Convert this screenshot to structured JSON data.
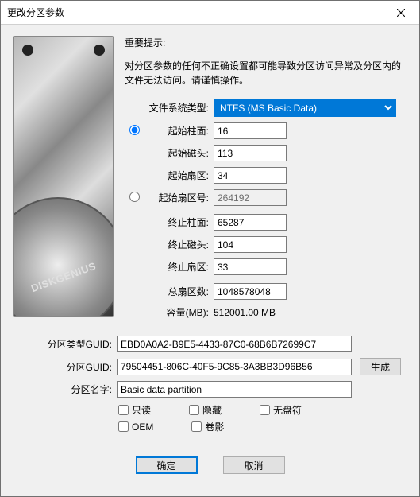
{
  "window": {
    "title": "更改分区参数"
  },
  "important_header": "重要提示:",
  "warning": "对分区参数的任何不正确设置都可能导致分区访问异常及分区内的文件无法访问。请谨慎操作。",
  "labels": {
    "fs_type": "文件系统类型:",
    "start_cyl": "起始柱面:",
    "start_head": "起始磁头:",
    "start_sector": "起始扇区:",
    "start_sector_no": "起始扇区号:",
    "end_cyl": "终止柱面:",
    "end_head": "终止磁头:",
    "end_sector": "终止扇区:",
    "total_sectors": "总扇区数:",
    "capacity_mb": "容量(MB):",
    "part_type_guid": "分区类型GUID:",
    "part_guid": "分区GUID:",
    "part_name": "分区名字:"
  },
  "values": {
    "fs_type": "NTFS (MS Basic Data)",
    "start_cyl": "16",
    "start_head": "113",
    "start_sector": "34",
    "start_sector_no": "264192",
    "end_cyl": "65287",
    "end_head": "104",
    "end_sector": "33",
    "total_sectors": "1048578048",
    "capacity_mb": "512001.00 MB",
    "part_type_guid": "EBD0A0A2-B9E5-4433-87C0-68B6B72699C7",
    "part_guid": "79504451-806C-40F5-9C85-3A3BB3D96B56",
    "part_name": "Basic data partition"
  },
  "checkboxes": {
    "readonly": "只读",
    "hidden": "隐藏",
    "no_drive_letter": "无盘符",
    "oem": "OEM",
    "shadow": "卷影"
  },
  "buttons": {
    "generate": "生成",
    "ok": "确定",
    "cancel": "取消"
  },
  "image_brand": "DISKGENIUS"
}
